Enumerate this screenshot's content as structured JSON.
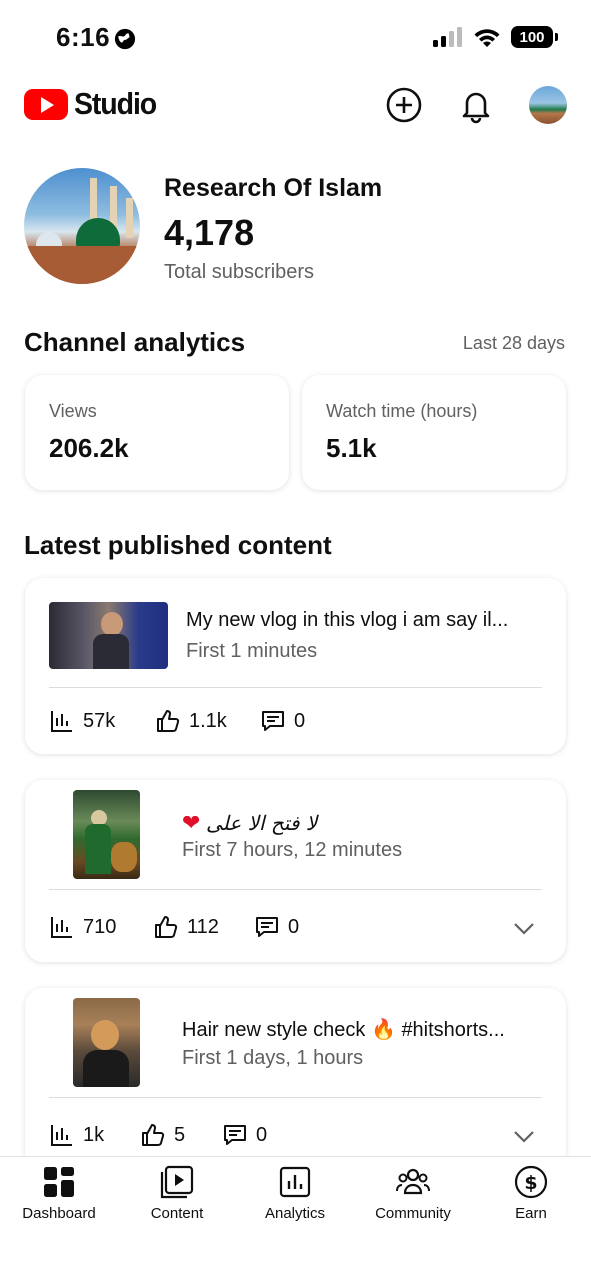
{
  "status": {
    "time": "6:16",
    "battery": "100"
  },
  "header": {
    "app_name": "Studio"
  },
  "channel": {
    "name": "Research Of Islam",
    "subscribers": "4,178",
    "subscribers_label": "Total subscribers"
  },
  "analytics": {
    "title": "Channel analytics",
    "range": "Last 28 days",
    "metrics": [
      {
        "label": "Views",
        "value": "206.2k"
      },
      {
        "label": "Watch time (hours)",
        "value": "5.1k"
      }
    ]
  },
  "latest": {
    "title": "Latest published content",
    "items": [
      {
        "title": "My new vlog in this vlog i am say il...",
        "time": "First 1 minutes",
        "views": "57k",
        "likes": "1.1k",
        "comments": "0"
      },
      {
        "title": "لا فتح الا علی",
        "time": "First 7 hours, 12 minutes",
        "views": "710",
        "likes": "112",
        "comments": "0"
      },
      {
        "title": "Hair new style check",
        "title_suffix": "#hitshorts...",
        "time": "First 1 days, 1 hours",
        "views": "1k",
        "likes": "5",
        "comments": "0"
      }
    ]
  },
  "nav": {
    "items": [
      {
        "label": "Dashboard",
        "icon": "dashboard-icon"
      },
      {
        "label": "Content",
        "icon": "content-icon"
      },
      {
        "label": "Analytics",
        "icon": "analytics-icon"
      },
      {
        "label": "Community",
        "icon": "community-icon"
      },
      {
        "label": "Earn",
        "icon": "earn-icon"
      }
    ]
  },
  "colors": {
    "brand_red": "#ff0000",
    "text": "#0f0f0f",
    "secondary": "#606060"
  }
}
